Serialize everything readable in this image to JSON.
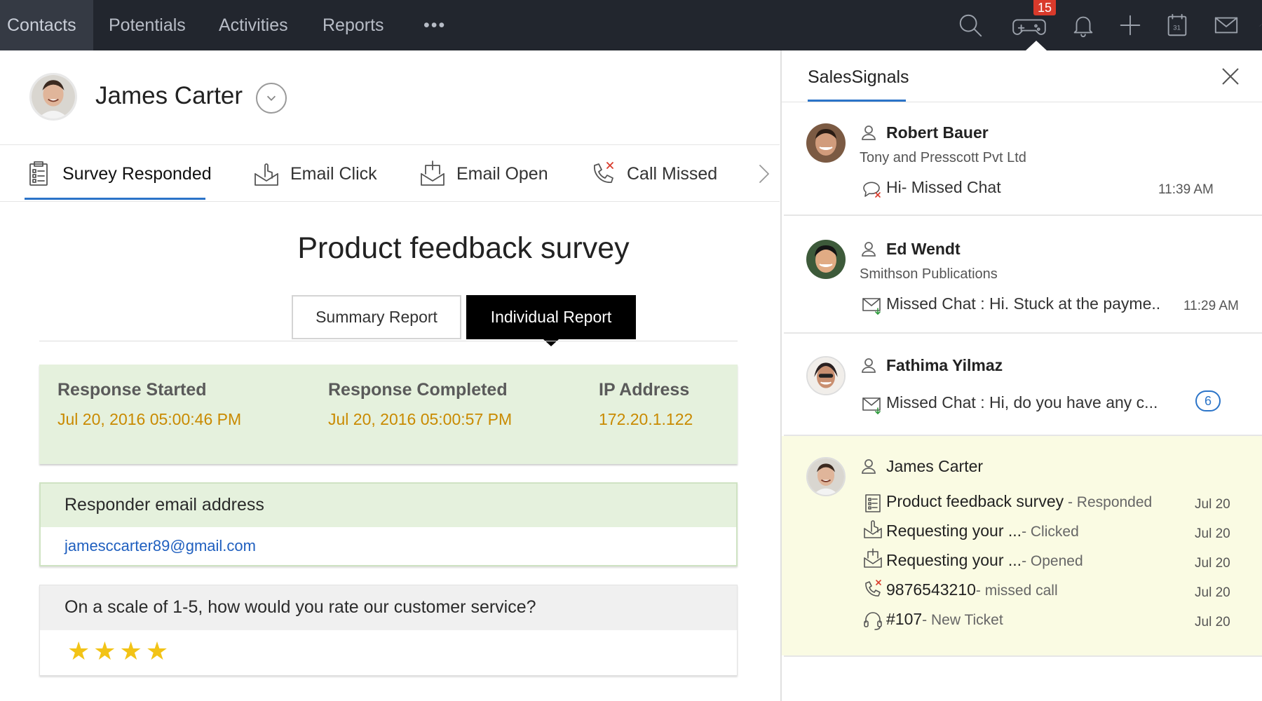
{
  "nav": {
    "items": [
      "Contacts",
      "Potentials",
      "Activities",
      "Reports"
    ],
    "more": "•••",
    "notification_count": "15"
  },
  "contact": {
    "name": "James Carter"
  },
  "tabs": [
    {
      "label": "Survey Responded",
      "icon": "clipboard-icon"
    },
    {
      "label": "Email Click",
      "icon": "email-click-icon"
    },
    {
      "label": "Email Open",
      "icon": "email-open-icon"
    },
    {
      "label": "Call Missed",
      "icon": "missed-call-icon"
    }
  ],
  "survey": {
    "title": "Product feedback survey",
    "summary_button": "Summary Report",
    "individual_button": "Individual Report",
    "response": {
      "started_label": "Response Started",
      "started_value": "Jul 20, 2016 05:00:46 PM",
      "completed_label": "Response Completed",
      "completed_value": "Jul 20, 2016 05:00:57 PM",
      "ip_label": "IP Address",
      "ip_value": "172.20.1.122"
    },
    "email_label": "Responder email address",
    "email_value": "jamesccarter89@gmail.com",
    "question": "On a scale of 1-5, how would you rate our customer service?",
    "rating": 4,
    "stars": "★★★★"
  },
  "sales_signals": {
    "title": "SalesSignals",
    "signals": [
      {
        "name": "Robert Bauer",
        "company": "Tony and Presscott Pvt Ltd",
        "message": "Hi- Missed Chat",
        "time": "11:39 AM"
      },
      {
        "name": "Ed Wendt",
        "company": "Smithson Publications",
        "message": "Missed Chat : Hi. Stuck at the payme..",
        "time": "11:29 AM"
      },
      {
        "name": "Fathima Yilmaz",
        "message": "Missed Chat : Hi, do you have any c...",
        "unread": "6"
      }
    ],
    "highlight": {
      "name": "James Carter",
      "activities": [
        {
          "main": "Product feedback survey",
          "status": " - Responded",
          "date": "Jul 20"
        },
        {
          "main": "Requesting your ...",
          "status": "- Clicked",
          "date": "Jul 20"
        },
        {
          "main": "Requesting your ...",
          "status": "- Opened",
          "date": "Jul 20"
        },
        {
          "main": "9876543210",
          "status": "- missed call",
          "date": "Jul 20"
        },
        {
          "main": "#107",
          "status": "- New Ticket",
          "date": "Jul 20"
        }
      ]
    }
  },
  "colors": {
    "nav_bg": "#22262e",
    "accent": "#2b74c8",
    "response_bg": "#e5f1dd",
    "response_value": "#c98a00",
    "star": "#f2c316",
    "highlight_bg": "#fafbe3",
    "badge": "#d93a2b"
  }
}
